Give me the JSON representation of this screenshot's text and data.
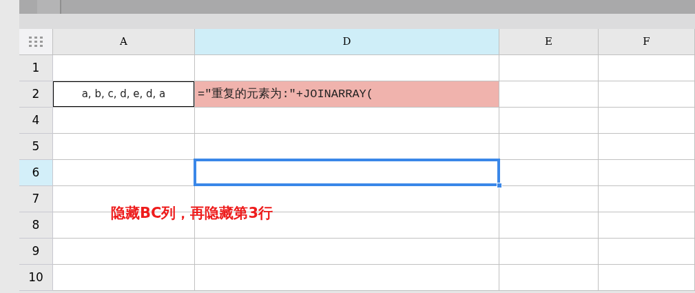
{
  "columns": [
    {
      "label": "A",
      "selected": false
    },
    {
      "label": "D",
      "selected": true
    },
    {
      "label": "E",
      "selected": false
    },
    {
      "label": "F",
      "selected": false
    }
  ],
  "rows": [
    {
      "label": "1",
      "selected": false,
      "cells": [
        {},
        {},
        {},
        {}
      ]
    },
    {
      "label": "2",
      "selected": false,
      "cells": [
        {
          "value": "a, b, c, d, e, d, a",
          "outlined": true
        },
        {
          "value": "=\"重复的元素为:\"+JOINARRAY(",
          "highlighted": true
        },
        {},
        {}
      ]
    },
    {
      "label": "4",
      "selected": false,
      "cells": [
        {},
        {},
        {},
        {}
      ]
    },
    {
      "label": "5",
      "selected": false,
      "cells": [
        {},
        {},
        {},
        {}
      ]
    },
    {
      "label": "6",
      "selected": true,
      "cells": [
        {},
        {
          "active": true
        },
        {},
        {}
      ]
    },
    {
      "label": "7",
      "selected": false,
      "cells": [
        {},
        {},
        {},
        {}
      ]
    },
    {
      "label": "8",
      "selected": false,
      "cells": [
        {},
        {},
        {},
        {}
      ]
    },
    {
      "label": "9",
      "selected": false,
      "cells": [
        {},
        {},
        {},
        {}
      ]
    },
    {
      "label": "10",
      "selected": false,
      "cells": [
        {},
        {},
        {},
        {}
      ]
    }
  ],
  "annotation": "隐藏BC列，再隐藏第3行"
}
